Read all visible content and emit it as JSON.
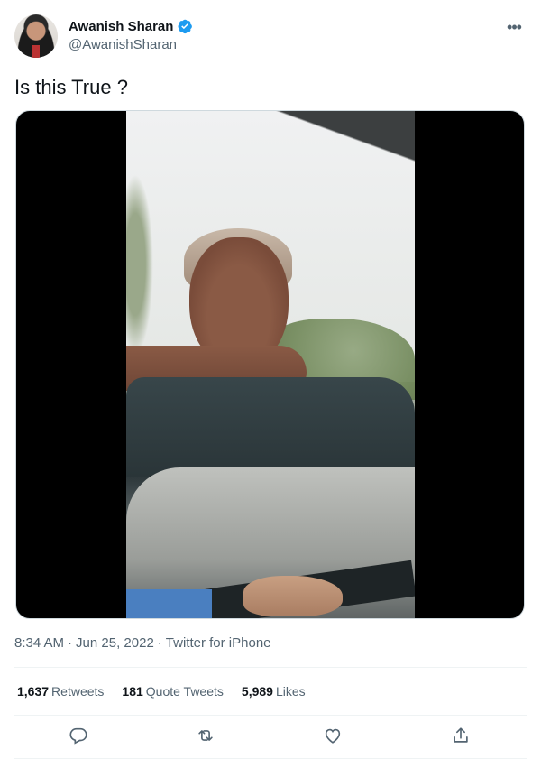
{
  "tweet": {
    "author": {
      "name": "Awanish Sharan",
      "handle": "@AwanishSharan",
      "verified": true
    },
    "text": "Is this True ?",
    "meta": {
      "time": "8:34 AM",
      "separator1": "·",
      "date": "Jun 25, 2022",
      "separator2": "·",
      "source": "Twitter for iPhone"
    },
    "stats": {
      "retweets": {
        "value": "1,637",
        "label": "Retweets"
      },
      "quote_tweets": {
        "value": "181",
        "label": "Quote Tweets"
      },
      "likes": {
        "value": "5,989",
        "label": "Likes"
      }
    },
    "actions": [
      "reply-icon",
      "retweet-icon",
      "like-icon",
      "share-icon"
    ]
  },
  "colors": {
    "text_primary": "#0f1419",
    "text_secondary": "#536471",
    "verified_blue": "#1d9bf0",
    "divider": "#eff3f4"
  }
}
